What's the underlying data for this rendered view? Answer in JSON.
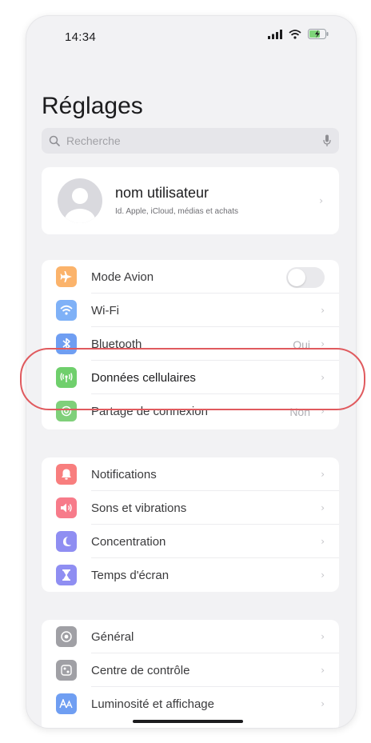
{
  "status": {
    "time": "14:34"
  },
  "header": {
    "title": "Réglages"
  },
  "search": {
    "placeholder": "Recherche"
  },
  "profile": {
    "name": "nom utilisateur",
    "subtitle": "Id. Apple, iCloud, médias et achats"
  },
  "connectivity": [
    {
      "label": "Mode Avion",
      "icon": "airplane-icon",
      "color": "#fbb36b",
      "control": "toggle",
      "toggle_on": false
    },
    {
      "label": "Wi-Fi",
      "icon": "wifi-icon",
      "color": "#7fb1f7"
    },
    {
      "label": "Bluetooth",
      "icon": "bluetooth-icon",
      "color": "#6f9ef2",
      "value": "Oui"
    },
    {
      "label": "Données cellulaires",
      "icon": "cellular-icon",
      "color": "#6fcf6c"
    },
    {
      "label": "Partage de connexion",
      "icon": "hotspot-icon",
      "color": "#7fd07a",
      "value": "Non"
    }
  ],
  "notifications": [
    {
      "label": "Notifications",
      "icon": "bell-icon",
      "color": "#f87e7e"
    },
    {
      "label": "Sons et vibrations",
      "icon": "speaker-icon",
      "color": "#f77b8a"
    },
    {
      "label": "Concentration",
      "icon": "moon-icon",
      "color": "#8f8ef2"
    },
    {
      "label": "Temps d'écran",
      "icon": "hourglass-icon",
      "color": "#8f8ef2"
    }
  ],
  "general": [
    {
      "label": "Général",
      "icon": "gear-icon",
      "color": "#a0a0a5"
    },
    {
      "label": "Centre de contrôle",
      "icon": "control-center-icon",
      "color": "#a0a0a5"
    },
    {
      "label": "Luminosité et affichage",
      "icon": "brightness-icon",
      "color": "#6f9ef2"
    }
  ],
  "annotation": {
    "highlight_color": "#e05a5e"
  }
}
